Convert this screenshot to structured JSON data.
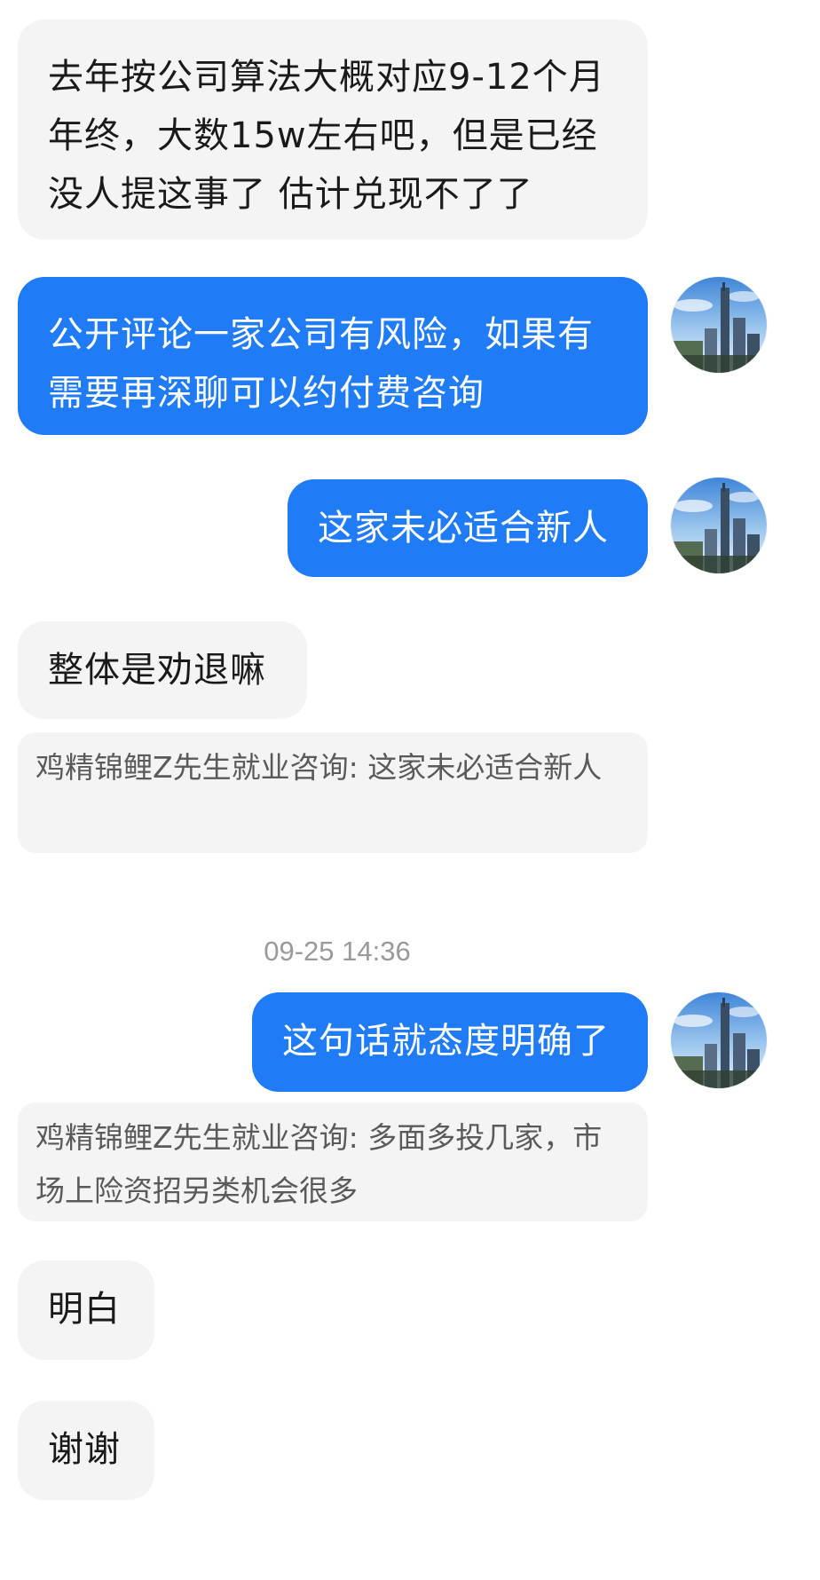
{
  "conversation": {
    "messages": [
      {
        "id": "m1",
        "side": "incoming",
        "text": "去年按公司算法大概对应9-12个月年终，大数15w左右吧，但是已经没人提这事了 估计兑现不了了"
      },
      {
        "id": "m2",
        "side": "outgoing",
        "text": "公开评论一家公司有风险，如果有需要再深聊可以约付费咨询"
      },
      {
        "id": "m3",
        "side": "outgoing",
        "text": "这家未必适合新人"
      },
      {
        "id": "m4",
        "side": "incoming",
        "text": "整体是劝退嘛",
        "quote": "鸡精锦鲤Z先生就业咨询: 这家未必适合新人"
      },
      {
        "id": "m5",
        "side": "outgoing",
        "text": "这句话就态度明确了",
        "quote": "鸡精锦鲤Z先生就业咨询: 多面多投几家，市场上险资招另类机会很多"
      },
      {
        "id": "m6",
        "side": "incoming",
        "text": "明白"
      },
      {
        "id": "m7",
        "side": "incoming",
        "text": "谢谢"
      }
    ],
    "timestamp": "09-25 14:36"
  },
  "colors": {
    "outgoing_bubble": "#1f7bf6",
    "incoming_bubble": "#f4f4f4",
    "timestamp_text": "#9a9a9a"
  },
  "icons": {
    "avatar": "city-skyline-avatar-icon"
  }
}
